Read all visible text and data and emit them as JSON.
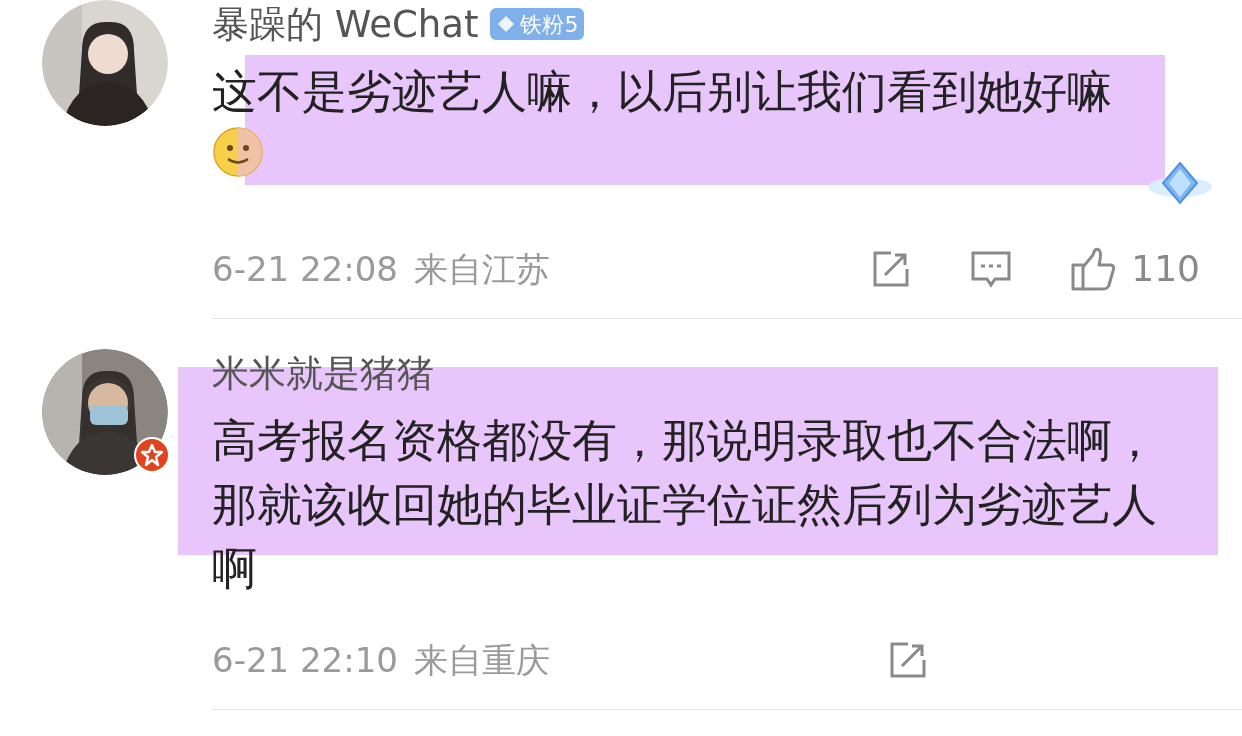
{
  "comments": [
    {
      "username": "暴躁的 WeChat",
      "badge": "铁粉5",
      "verified": false,
      "text": "这不是劣迹艺人嘛，以后别让我们看到她好嘛",
      "emoji": true,
      "highlighted": true,
      "time": "6-21 22:08",
      "location": "来自江苏",
      "actions": [
        {
          "kind": "share"
        },
        {
          "kind": "comment"
        },
        {
          "kind": "like",
          "count": "110"
        }
      ]
    },
    {
      "username": "米米就是猪猪",
      "verified": true,
      "text": "高考报名资格都没有，那说明录取也不合法啊，那就该收回她的毕业证学位证然后列为劣迹艺人啊",
      "emoji": false,
      "highlighted": true,
      "time": "6-21 22:10",
      "location": "来自重庆",
      "actions": [
        {
          "kind": "share"
        }
      ]
    }
  ]
}
